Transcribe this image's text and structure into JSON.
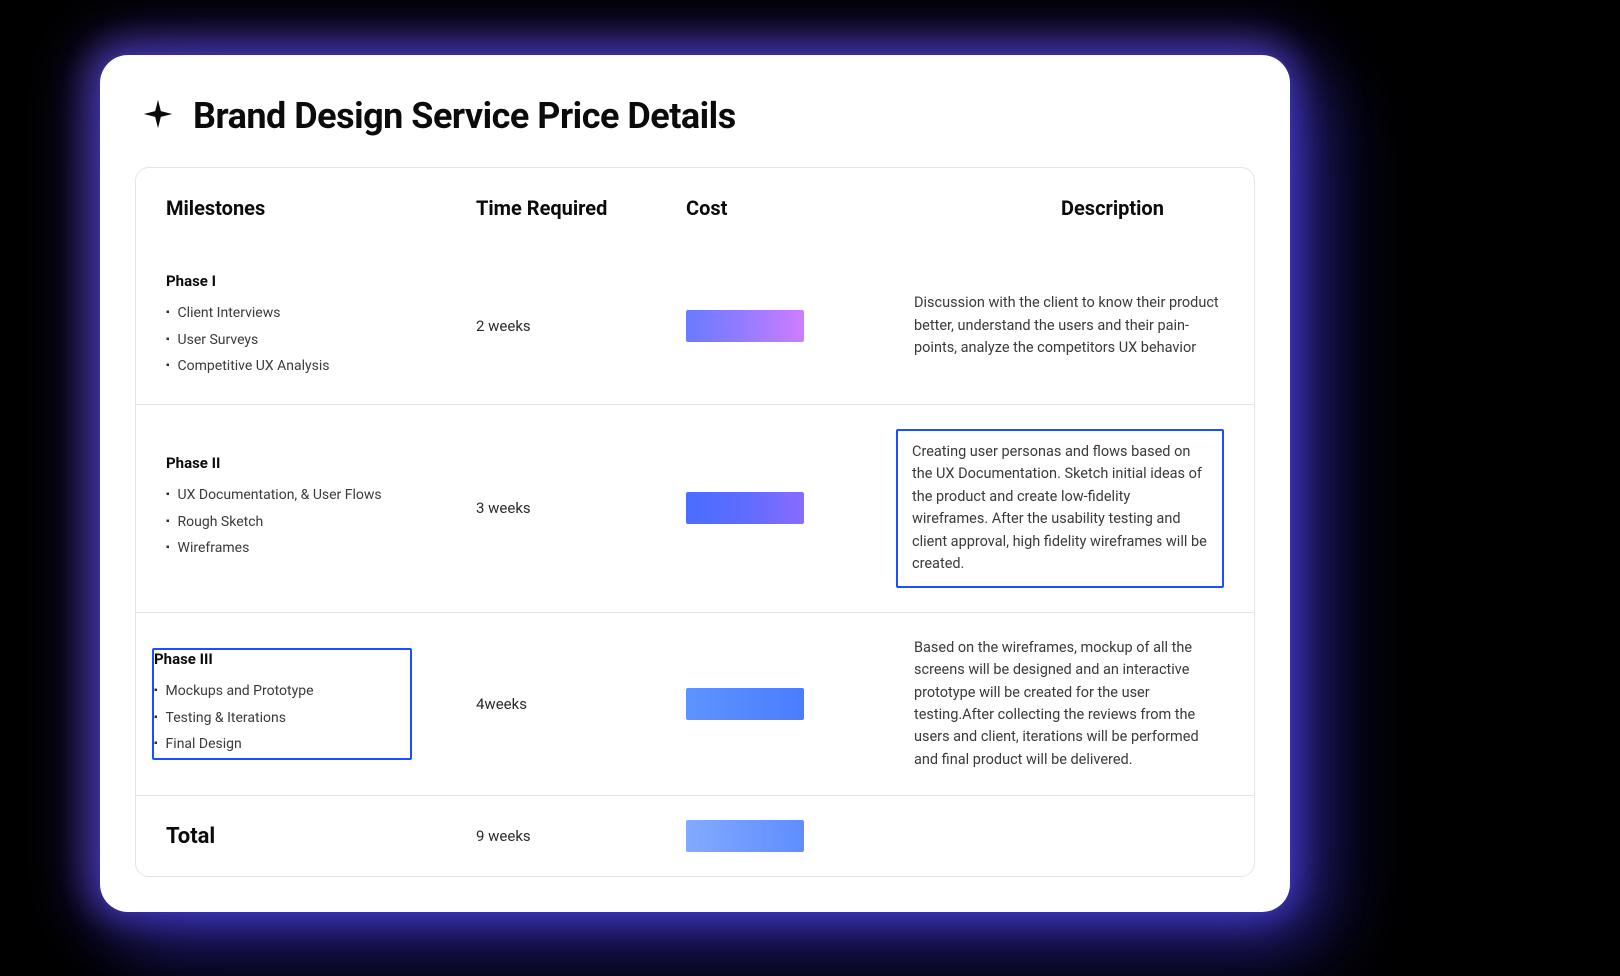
{
  "title": "Brand Design Service Price Details",
  "headers": {
    "milestones": "Milestones",
    "time": "Time Required",
    "cost": "Cost",
    "description": "Description"
  },
  "rows": [
    {
      "phase": "Phase I",
      "items": [
        "Client Interviews",
        "User Surveys",
        "Competitive UX Analysis"
      ],
      "time": "2 weeks",
      "cost_gradient": "linear-gradient(90deg,#6a7bff 0%,#8c7bff 40%,#cf7dff 100%)",
      "description": "Discussion with the client to know their product better, understand the users and their pain-points, analyze the competitors UX behavior",
      "highlight_left": false,
      "highlight_desc": false
    },
    {
      "phase": "Phase II",
      "items": [
        "UX Documentation, & User Flows",
        "Rough Sketch",
        "Wireframes"
      ],
      "time": "3 weeks",
      "cost_gradient": "linear-gradient(90deg,#4a6dff 0%,#5d6dff 50%,#8a6bff 100%)",
      "description": "Creating user personas and flows based on the UX Documentation. Sketch initial ideas of the product and create low-fidelity wireframes. After the usability testing and client approval, high fidelity wireframes will be created.",
      "highlight_left": false,
      "highlight_desc": true
    },
    {
      "phase": "Phase III",
      "items": [
        "Mockups and Prototype",
        "Testing & Iterations",
        "Final Design"
      ],
      "time": "4weeks",
      "cost_gradient": "linear-gradient(90deg,#5e93ff 0%,#4a7dff 100%)",
      "description": "Based on the wireframes, mockup of all the screens will be designed and an interactive prototype will be created for the user testing.After collecting the reviews from the users and client, iterations will be performed and final product will be delivered.",
      "highlight_left": true,
      "highlight_desc": false
    }
  ],
  "total": {
    "label": "Total",
    "time": "9 weeks",
    "cost_gradient": "linear-gradient(90deg,#82aaff 0%,#5e8dff 100%)"
  }
}
